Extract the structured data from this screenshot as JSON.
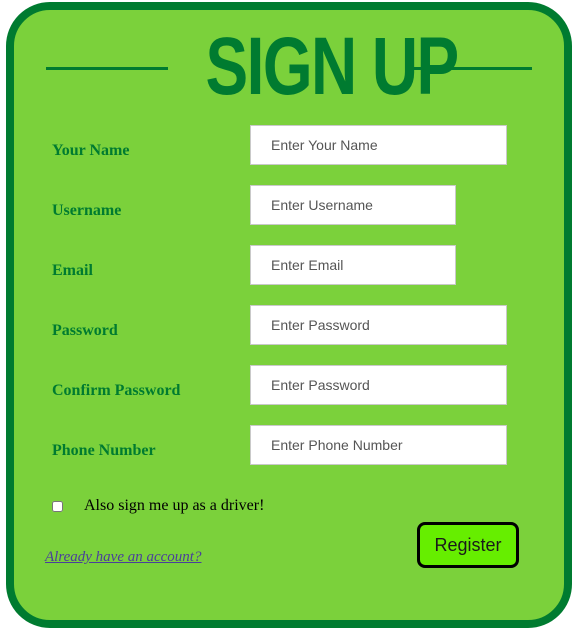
{
  "form": {
    "title": "SIGN UP",
    "fields": [
      {
        "label": "Your Name",
        "placeholder": "Enter Your Name",
        "value": ""
      },
      {
        "label": "Username",
        "placeholder": "Enter Username",
        "value": ""
      },
      {
        "label": "Email",
        "placeholder": "Enter Email",
        "value": ""
      },
      {
        "label": "Password",
        "placeholder": "Enter Password",
        "value": ""
      },
      {
        "label": "Confirm Password",
        "placeholder": "Enter Password",
        "value": ""
      },
      {
        "label": "Phone Number",
        "placeholder": "Enter Phone Number",
        "value": ""
      }
    ],
    "driver_checkbox": {
      "label": "Also sign me up as a driver!",
      "checked": false
    },
    "login_link": "Already have an account?",
    "register_label": "Register"
  },
  "colors": {
    "card_background": "#7bd13b",
    "card_border": "#007b30",
    "label_text": "#007b30",
    "register_button": "#66ee00",
    "link": "#4a3f9b"
  }
}
